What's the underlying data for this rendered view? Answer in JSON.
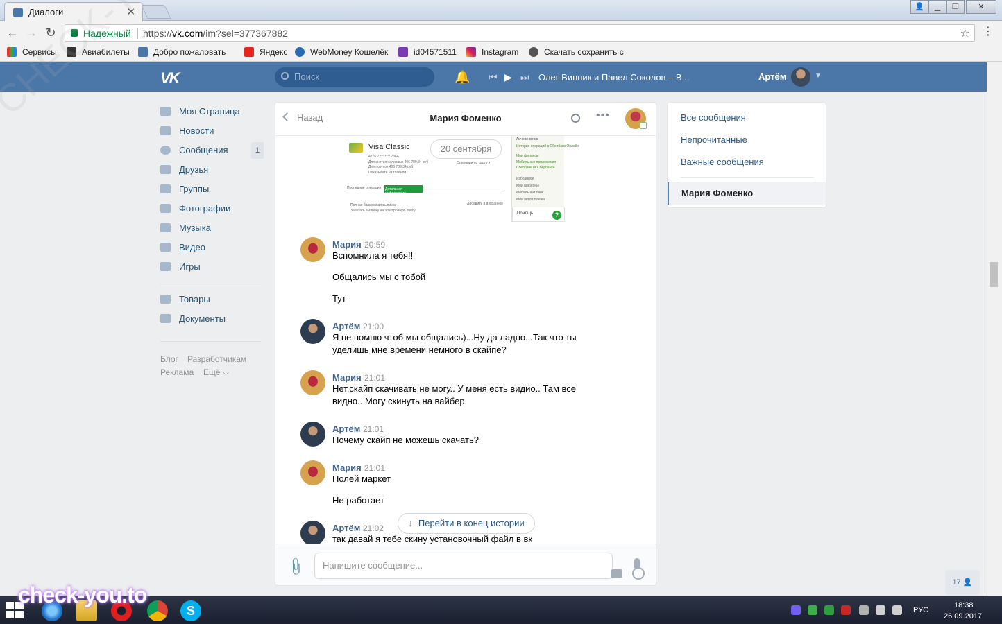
{
  "browser": {
    "tab_title": "Диалоги",
    "secure_label": "Надежный",
    "url_prefix": "https://",
    "url_host": "vk.com",
    "url_path": "/im?sel=377367882",
    "bookmarks": [
      "Сервисы",
      "Авиабилеты",
      "Добро пожаловать",
      "Яндекс",
      "WebMoney Кошелёк",
      "id04571511",
      "Instagram",
      "Скачать сохранить с"
    ]
  },
  "header": {
    "search_placeholder": "Поиск",
    "track": "Олег Винник и Павел Соколов – В...",
    "user_name": "Артём"
  },
  "left_menu": {
    "items": [
      "Моя Страница",
      "Новости",
      "Сообщения",
      "Друзья",
      "Группы",
      "Фотографии",
      "Музыка",
      "Видео",
      "Игры"
    ],
    "items2": [
      "Товары",
      "Документы"
    ],
    "messages_badge": "1",
    "footer": [
      "Блог",
      "Разработчикам",
      "Реклама",
      "Ещё ⌵"
    ]
  },
  "chat": {
    "back_label": "Назад",
    "title": "Мария Фоменко",
    "date_pill": "20 сентября",
    "screenshot": {
      "card_name": "Visa Classic",
      "card_lines": [
        "4276 72** **** 7364",
        "Для снятия наличных   406 789,34 руб",
        "Для покупок            406 789,34 руб",
        "Показывать на главной"
      ],
      "ops_btn": "Операции по карте ▾",
      "tab_recent": "Последние операции",
      "tab_details": "Детальная информация",
      "link1": "Полная банковская выписка",
      "link2": "Заказать выписку на электронную почту",
      "link3": "Добавить в избранное",
      "side_title": "Личное меню",
      "side_items": [
        "История операций в Сбербанк Онлайн",
        "Мои финансы",
        "Мобильные приложения",
        "Сбербанк от Сбербанка",
        "Избранное",
        "Мои шаблоны",
        "Мобильный банк",
        "Мои автоплатежи"
      ],
      "help": "Помощь"
    },
    "messages": [
      {
        "author": "Мария",
        "time": "20:59",
        "lines": [
          "Вспомнила я тебя!!",
          "Общались мы с тобой",
          "Тут"
        ]
      },
      {
        "author": "Артём",
        "time": "21:00",
        "lines": [
          "Я не помню чтоб мы общались)...Ну да ладно...Так что ты удели­шь мне времени немного в скайпе?"
        ]
      },
      {
        "author": "Мария",
        "time": "21:01",
        "lines": [
          "Нет,скайп скачивать не могу.. У меня есть видио.. Там все видно.. Могу скинуть на вайбер."
        ]
      },
      {
        "author": "Артём",
        "time": "21:01",
        "lines": [
          "Почему скайп не можешь скачать?"
        ]
      },
      {
        "author": "Мария",
        "time": "21:01",
        "lines": [
          "Полей маркет",
          "Не работает"
        ]
      },
      {
        "author": "Артём",
        "time": "21:02",
        "lines": [
          "так давай я тебе скину установочный файл в вк"
        ]
      }
    ],
    "goto_end": "Перейти в конец истории",
    "input_placeholder": "Напишите сообщение..."
  },
  "right_panel": {
    "filters": [
      "Все сообщения",
      "Непрочитанные",
      "Важные сообщения"
    ],
    "active_dialog": "Мария Фоменко"
  },
  "online_count": "17",
  "taskbar": {
    "lang": "РУС",
    "time": "18:38",
    "date": "26.09.2017"
  },
  "watermark": {
    "logo": "check-you.to",
    "diagonal": "CHECK-YOU.ME"
  },
  "colors": {
    "vk_blue": "#4a76a8",
    "link": "#2a5885",
    "author": "#42648b",
    "secure_green": "#0b8043"
  }
}
